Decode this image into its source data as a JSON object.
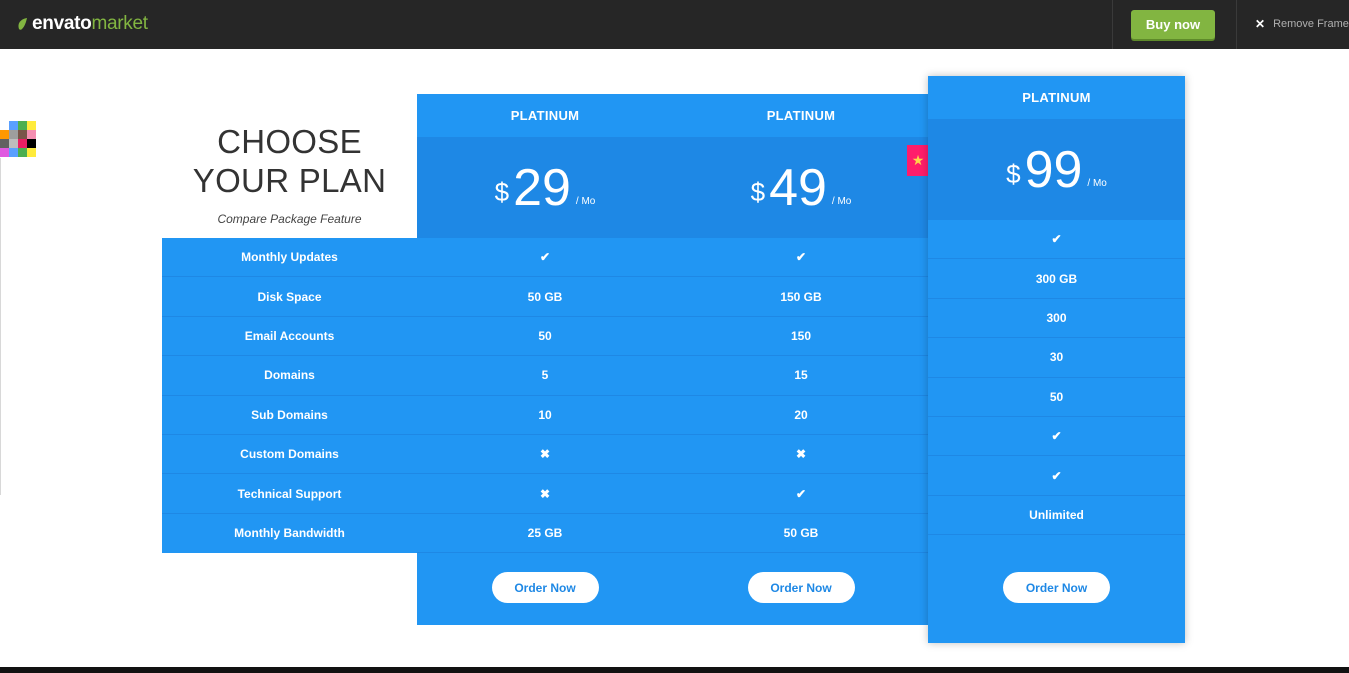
{
  "topbar": {
    "logo_envato": "envato",
    "logo_market": "market",
    "buy_label": "Buy now",
    "remove_label": "Remove Frame",
    "remove_icon": "close-icon",
    "colors": {
      "bg": "#262626",
      "buy": "#82b541"
    }
  },
  "heading": {
    "line1": "CHOOSE",
    "line2": "YOUR PLAN",
    "subtitle": "Compare Package Feature"
  },
  "features": [
    "Monthly Updates",
    "Disk Space",
    "Email Accounts",
    "Domains",
    "Sub Domains",
    "Custom Domains",
    "Technical Support",
    "Monthly Bandwidth"
  ],
  "plans": [
    {
      "name": "PLATINUM",
      "currency": "$",
      "amount": "29",
      "per": "/ Mo",
      "values": [
        "check",
        "50 GB",
        "50",
        "5",
        "10",
        "cross",
        "cross",
        "25 GB"
      ],
      "order_label": "Order Now"
    },
    {
      "name": "PLATINUM",
      "currency": "$",
      "amount": "49",
      "per": "/ Mo",
      "values": [
        "check",
        "150 GB",
        "150",
        "15",
        "20",
        "cross",
        "check",
        "50 GB"
      ],
      "order_label": "Order Now"
    },
    {
      "name": "PLATINUM",
      "currency": "$",
      "amount": "99",
      "per": "/ Mo",
      "values": [
        "check",
        "300 GB",
        "300",
        "30",
        "50",
        "check",
        "check",
        "Unlimited"
      ],
      "order_label": "Order Now",
      "featured": true
    }
  ],
  "badge_icon": "star-icon",
  "theme": {
    "primary": "#2196f3",
    "primary_dark": "#1e88e5",
    "badge": "#ff1d6b"
  },
  "swatch_colors": [
    "#e05ae0",
    "#5aa0ff",
    "#4caf50",
    "#ffeb3b",
    "#ff9800",
    "#9e9e9e",
    "#795548",
    "#f48fb1",
    "#616161",
    "#bdbdbd",
    "#e91e63",
    "#000000"
  ]
}
